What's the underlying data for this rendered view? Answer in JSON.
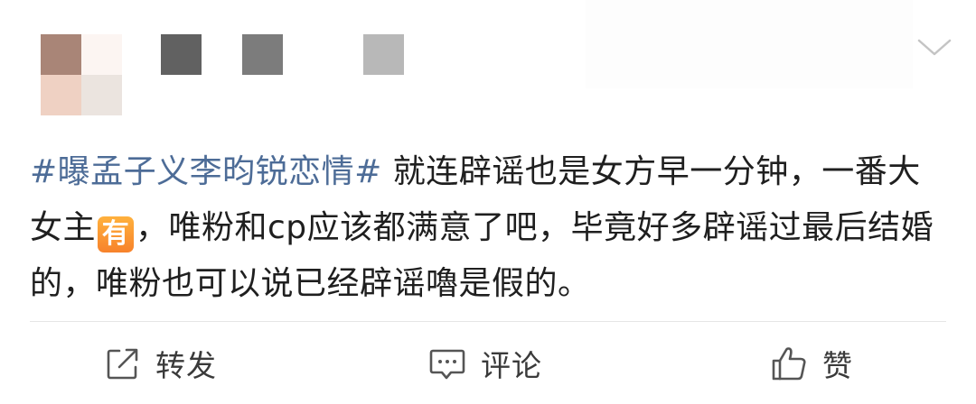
{
  "post": {
    "hashtag": "#曝孟子义李昀锐恋情#",
    "text_part1": " 就连辟谣也是女方早一分钟，一番大女主",
    "emoji_icon_text": "有",
    "text_part2": "，唯粉和cp应该都满意了吧，毕竟好多辟谣过最后结婚的，唯粉也可以说已经辟谣嚕是假的。"
  },
  "actions": {
    "repost_label": "转发",
    "comment_label": "评论",
    "like_label": "赞"
  },
  "colors": {
    "hashtag": "#4d6c97",
    "text": "#1f1f1f",
    "action_text": "#3a3a3a",
    "divider": "#e6e6e6",
    "emoji_badge": "#f7922f"
  },
  "icons": {
    "menu": "chevron-down-icon",
    "repost": "repost-icon",
    "comment": "comment-icon",
    "like": "thumbs-up-icon",
    "emoji": "you-emoji-icon"
  }
}
